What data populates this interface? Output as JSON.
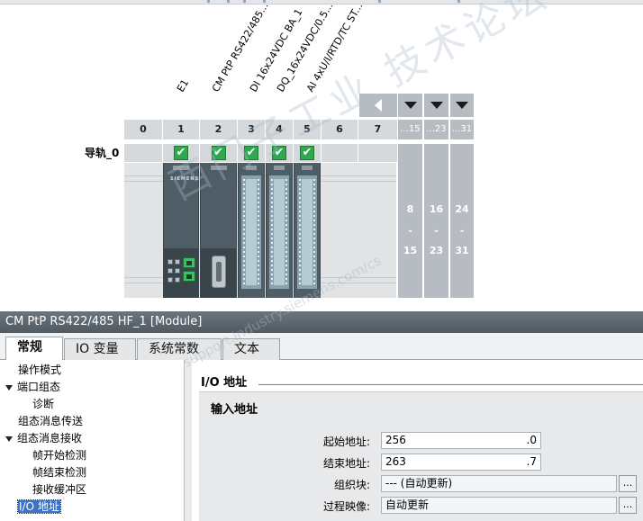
{
  "modules": {
    "labels": [
      "E1",
      "CM PtP RS422/485...",
      "DI 16x24VDC BA_1",
      "DQ_16x24VDC/0.5...",
      "AI 4xU/I/RTD/TC ST..."
    ]
  },
  "rack": {
    "rail_name": "导轨_0",
    "slots": [
      "0",
      "1",
      "2",
      "3",
      "4",
      "5",
      "6",
      "7"
    ],
    "expansion_heads": [
      "...15",
      "...23",
      "...31"
    ],
    "expansion_ranges": [
      {
        "from": "8",
        "dash": "-",
        "to": "15"
      },
      {
        "from": "16",
        "dash": "-",
        "to": "23"
      },
      {
        "from": "24",
        "dash": "-",
        "to": "31"
      }
    ],
    "check_mark": "✔",
    "brand": "SIEMENS"
  },
  "watermark": {
    "text": "西门子工业 技术论坛",
    "url": "support.industry.siemens.com/cs"
  },
  "properties": {
    "title": "CM PtP RS422/485 HF_1 [Module]",
    "tabs": [
      "常规",
      "IO 变量",
      "系统常数",
      "文本"
    ],
    "active_tab": "常规",
    "nav": [
      {
        "label": "操作模式",
        "level": 0,
        "expander": false
      },
      {
        "label": "端口组态",
        "level": 0,
        "expander": true
      },
      {
        "label": "诊断",
        "level": 1,
        "expander": false
      },
      {
        "label": "组态消息传送",
        "level": 0,
        "expander": false
      },
      {
        "label": "组态消息接收",
        "level": 0,
        "expander": true
      },
      {
        "label": "帧开始检测",
        "level": 1,
        "expander": false
      },
      {
        "label": "帧结束检测",
        "level": 1,
        "expander": false
      },
      {
        "label": "接收缓冲区",
        "level": 1,
        "expander": false
      },
      {
        "label": "I/O 地址",
        "level": 0,
        "expander": false,
        "selected": true
      }
    ],
    "section_title": "I/O 地址",
    "group_title": "输入地址",
    "fields": {
      "start_label": "起始地址:",
      "start_value": "256",
      "start_suffix": ".0",
      "end_label": "结束地址:",
      "end_value": "263",
      "end_suffix": ".7",
      "ob_label": "组织块:",
      "ob_value": "--- (自动更新)",
      "pi_label": "过程映像:",
      "pi_value": "自动更新",
      "dots": "..."
    }
  }
}
